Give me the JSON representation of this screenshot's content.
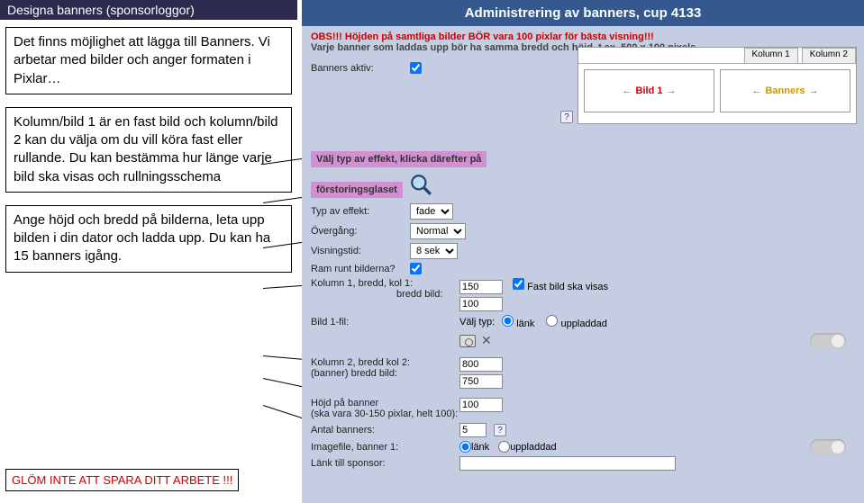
{
  "left": {
    "section_title": "Designa banners (sponsorloggor)",
    "callout1": "Det finns möjlighet att lägga till Banners. Vi arbetar med bilder och anger formaten i Pixlar…",
    "callout2": "Kolumn/bild 1 är en fast bild och kolumn/bild 2 kan du välja om du vill köra fast eller rullande. Du kan bestämma hur länge varje bild ska visas och rullningsschema",
    "callout3": "Ange höjd och bredd på bilderna, leta upp bilden i din dator och ladda upp. Du kan ha 15 banners igång.",
    "footer": "GLÖM INTE ATT SPARA DITT ARBETE !!!"
  },
  "admin": {
    "title": "Administrering av banners, cup 4133",
    "warn1": "OBS!!! Höjden på samtliga bilder BÖR vara 100 pixlar för bästa visning!!!",
    "warn2": "Varje banner som laddas upp bör ha samma bredd och höjd, t.ex. 500 x 100 pixels.",
    "banners_aktiv_label": "Banners aktiv:",
    "preview_tab1": "Kolumn 1",
    "preview_tab2": "Kolumn 2",
    "preview_bild": "Bild 1",
    "preview_banners": "Banners",
    "hilite1": "Välj typ av effekt, klicka därefter på",
    "hilite2": "förstoringsglaset",
    "typ_av_effekt_label": "Typ av effekt:",
    "typ_av_effekt_value": "fade",
    "overgang_label": "Övergång:",
    "overgang_value": "Normal",
    "visningstid_label": "Visningstid:",
    "visningstid_value": "8 sek",
    "ram_label": "Ram runt bilderna?",
    "kol1_label": "Kolumn 1, bredd, kol 1:",
    "kol1_sub": "bredd bild:",
    "kol1_val1": "150",
    "kol1_check": "Fast bild ska visas",
    "kol1_val2": "100",
    "bild1fil_label": "Bild 1-fil:",
    "valj_typ_label": "Välj typ:",
    "radio_lank": "länk",
    "radio_uppladdad": "uppladdad",
    "kol2_label": "Kolumn 2, bredd kol 2:",
    "kol2_sub": "(banner)    bredd bild:",
    "kol2_val1": "800",
    "kol2_val2": "750",
    "hojd_label1": "Höjd på banner",
    "hojd_label2": "(ska vara 30-150 pixlar, helt 100):",
    "hojd_val": "100",
    "antal_label": "Antal banners:",
    "antal_val": "5",
    "imagefile_label": "Imagefile, banner 1:",
    "imagefile_radio_lank": "länk",
    "imagefile_radio_uppladdad": "uppladdad",
    "lank_sponsor_label": "Länk till sponsor:"
  }
}
